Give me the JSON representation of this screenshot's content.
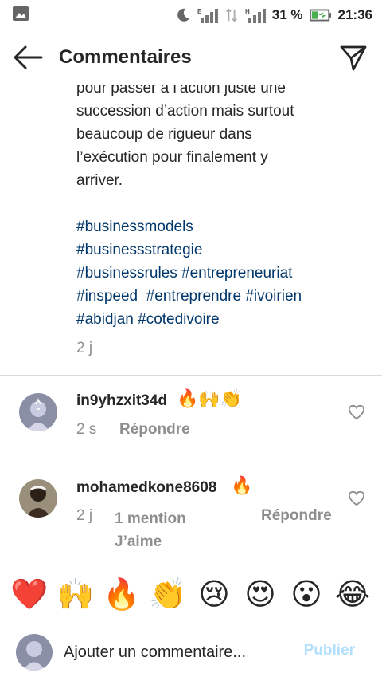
{
  "status_bar": {
    "battery": "31 %",
    "time": "21:36",
    "icons": [
      "gallery-icon",
      "moon-icon",
      "signal-e-icon",
      "data-arrows-icon",
      "signal-h-icon",
      "battery-charging-icon"
    ]
  },
  "header": {
    "title": "Commentaires",
    "icons": [
      "back-arrow-icon",
      "send-icon"
    ]
  },
  "caption": {
    "text": "pour passer à l’action juste une\nsuccession d’action mais surtout\nbeaucoup de rigueur dans\nl’exécution pour finalement y\narriver.",
    "hashtags": "#businessmodels\n#businessstrategie\n#businessrules #entrepreneuriat\n#inspeed  #entreprendre #ivoirien\n#abidjan #cotedivoire",
    "time": "2 j"
  },
  "comments": [
    {
      "username": "in9yhzxit34d",
      "emojis": "🔥🙌👏",
      "time": "2 s",
      "reply_label": "Répondre"
    },
    {
      "username": "mohamedkone8608",
      "emojis": "🔥",
      "time": "2 j",
      "mention_label": "1 mention\nJ’aime",
      "reply_label": "Répondre"
    }
  ],
  "emoji_bar": [
    "❤️",
    "🙌",
    "🔥",
    "👏",
    "😢",
    "😍",
    "😮",
    "😂"
  ],
  "composer": {
    "placeholder": "Ajouter un commentaire...",
    "publish_label": "Publier"
  },
  "colors": {
    "hashtag": "#00376b",
    "muted": "#8e8e8e",
    "publish_disabled": "#b2dffc"
  }
}
